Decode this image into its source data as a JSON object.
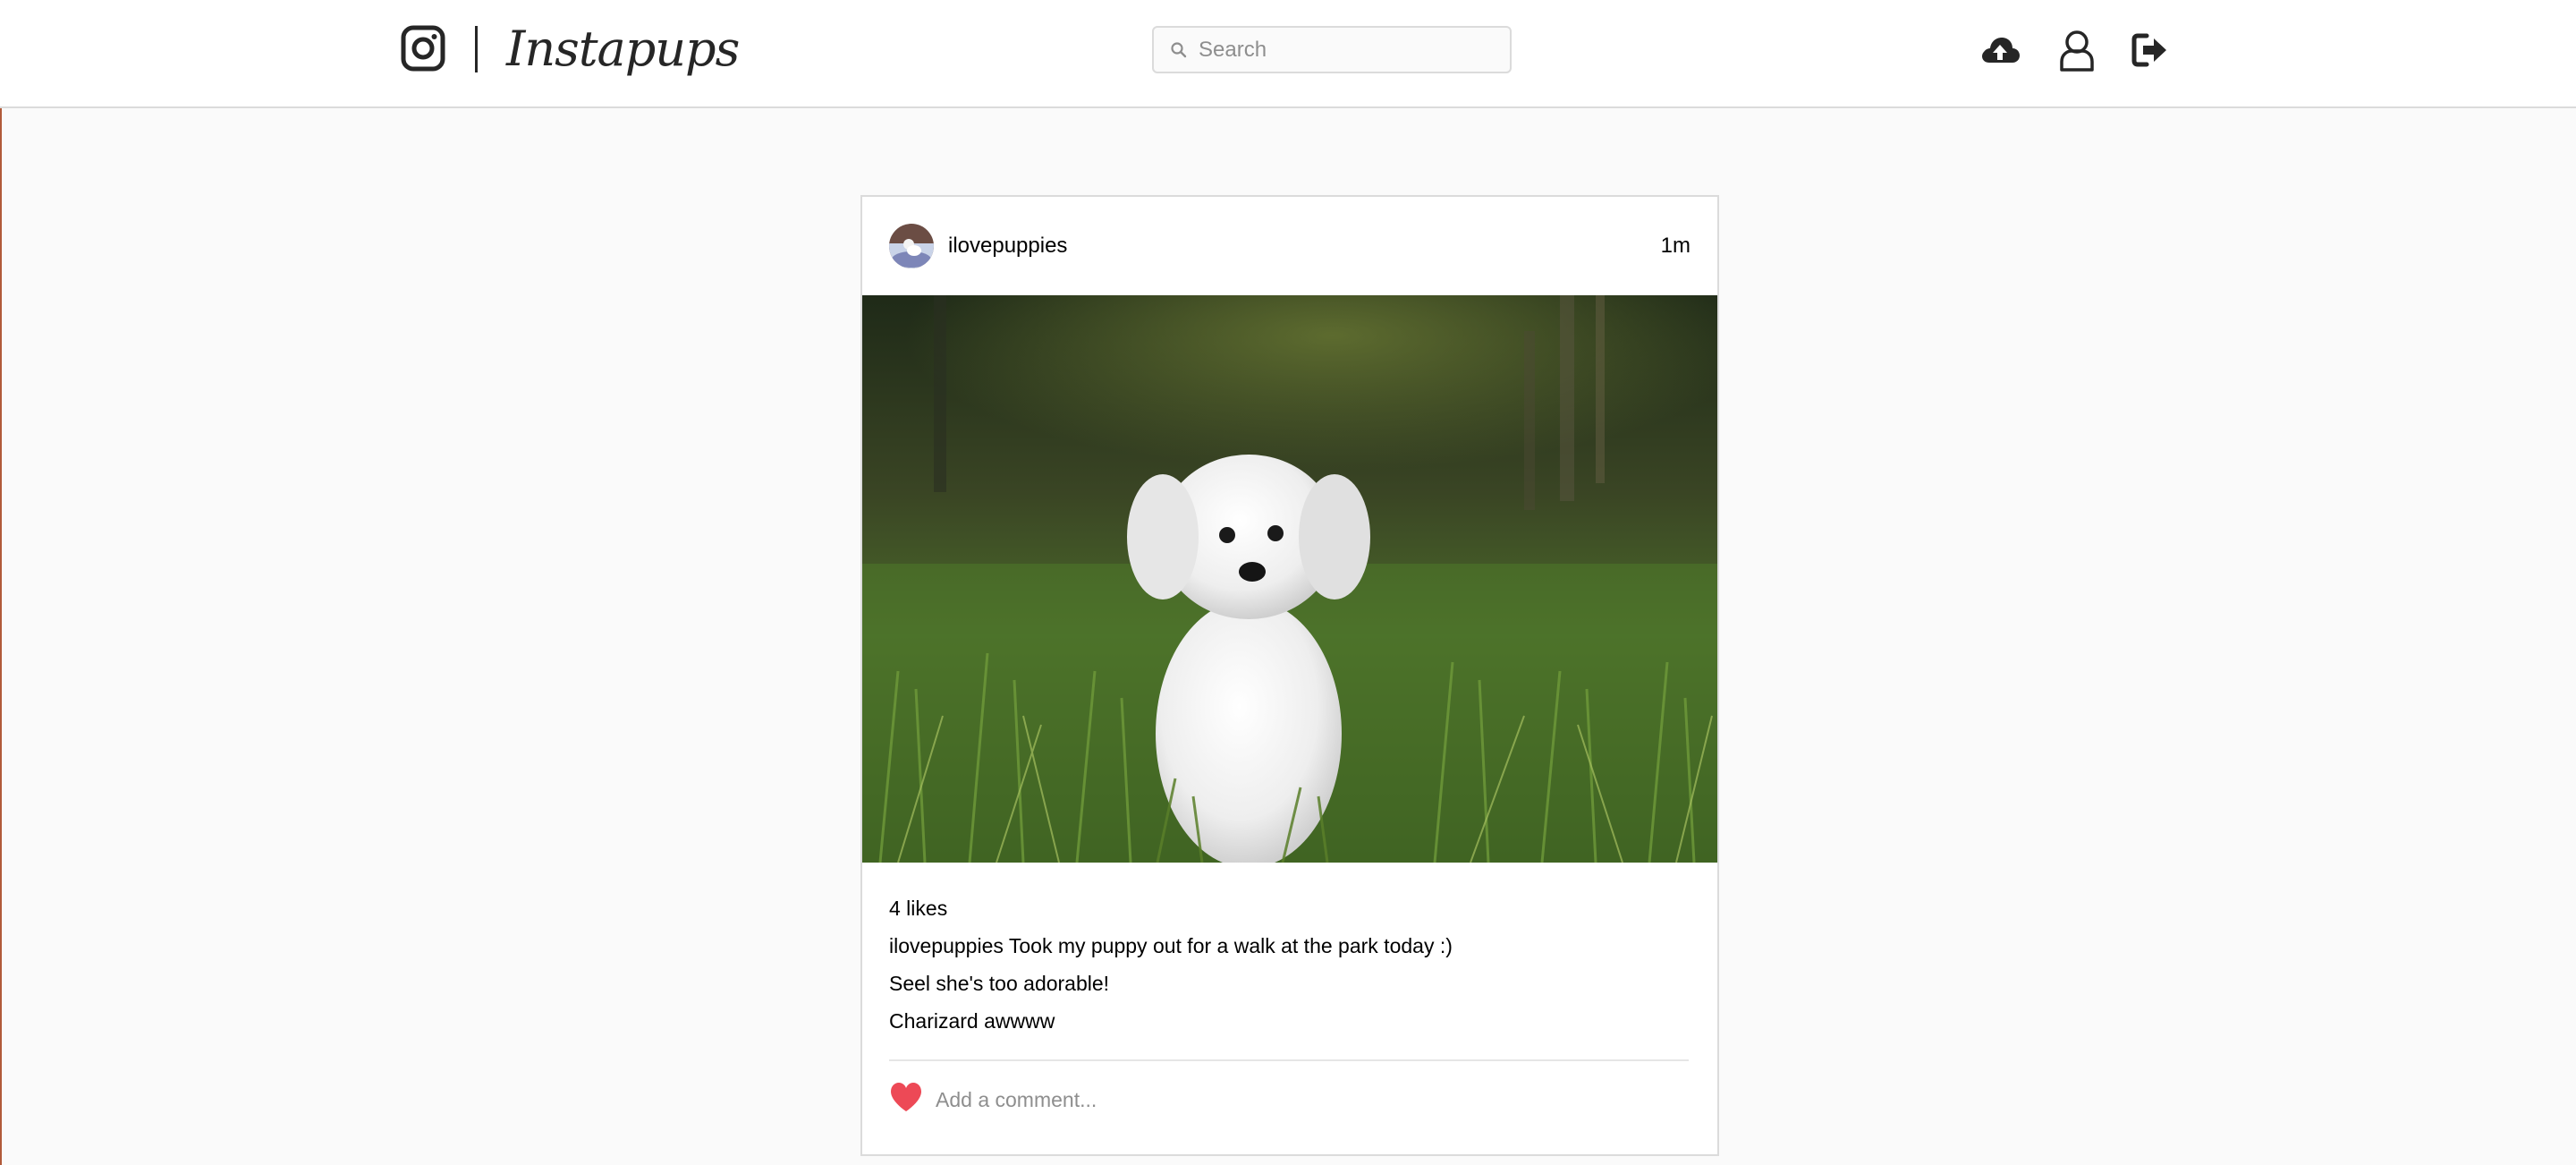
{
  "header": {
    "brand": "Instapups",
    "logo_icon": "instagram-camera-icon",
    "search": {
      "placeholder": "Search",
      "value": ""
    },
    "nav_icons": [
      "cloud-upload-icon",
      "user-profile-icon",
      "logout-icon"
    ]
  },
  "post": {
    "username": "ilovepuppies",
    "time": "1m",
    "image": "white-puppy-in-grass-photo",
    "likes": "4 likes",
    "caption": {
      "author": "ilovepuppies",
      "text": "Took my puppy out for a walk at the park today :)"
    },
    "comments": [
      {
        "text": "Seel she's too adorable!"
      },
      {
        "text": "Charizard awwww"
      }
    ],
    "like_icon": "heart-icon",
    "like_color": "#ed4956",
    "comment_placeholder": "Add a comment..."
  }
}
